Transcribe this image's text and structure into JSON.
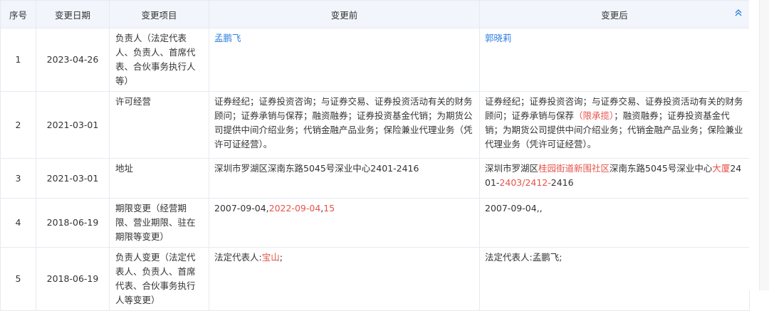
{
  "header": {
    "seq": "序号",
    "date": "变更日期",
    "item": "变更项目",
    "before": "变更前",
    "after": "变更后",
    "collapse_icon": "chevrons-up-icon",
    "accent": "#2f7fe0"
  },
  "highlight_color": "#e5534b",
  "rows": [
    {
      "seq": "1",
      "date": "2023-04-26",
      "item": "负责人（法定代表人、负责人、首席代表、合伙事务执行人等）",
      "before": [
        {
          "t": "孟鹏飞",
          "c": "link"
        }
      ],
      "after": [
        {
          "t": "郭晓莉",
          "c": "link"
        }
      ]
    },
    {
      "seq": "2",
      "date": "2021-03-01",
      "item": "许可经营",
      "before": [
        {
          "t": "证券经纪；证券投资咨询；与证券交易、证券投资活动有关的财务顾问；证券承销与保荐；融资融券；证券投资基金代销；为期货公司提供中间介绍业务；代销金融产品业务；保险兼业代理业务（凭许可证经营）。",
          "c": ""
        }
      ],
      "after": [
        {
          "t": "证券经纪；证券投资咨询；与证券交易、证券投资活动有关的财务顾问；证券承销与保荐",
          "c": ""
        },
        {
          "t": "（限承揽）",
          "c": "hl"
        },
        {
          "t": "；融资融券；证券投资基金代销；为期货公司提供中间介绍业务；代销金融产品业务；保险兼业代理业务（凭许可证经营）。",
          "c": ""
        }
      ]
    },
    {
      "seq": "3",
      "date": "2021-03-01",
      "item": "地址",
      "before": [
        {
          "t": "深圳市罗湖区深南东路5045号深业中心2401-2416",
          "c": ""
        }
      ],
      "after": [
        {
          "t": "深圳市罗湖区",
          "c": ""
        },
        {
          "t": "桂园街道新围社区",
          "c": "hl"
        },
        {
          "t": "深南东路5045号深业中心",
          "c": ""
        },
        {
          "t": "大厦",
          "c": "hl"
        },
        {
          "t": "2401-",
          "c": ""
        },
        {
          "t": "2403/2412-",
          "c": "hl"
        },
        {
          "t": "2416",
          "c": ""
        }
      ]
    },
    {
      "seq": "4",
      "date": "2018-06-19",
      "item": "期限变更（经营期限、营业期限、驻在期限等变更）",
      "before": [
        {
          "t": "2007-09-04,",
          "c": ""
        },
        {
          "t": "2022-09-04",
          "c": "hl"
        },
        {
          "t": ",",
          "c": ""
        },
        {
          "t": "15",
          "c": "hl"
        }
      ],
      "after": [
        {
          "t": "2007-09-04,,",
          "c": ""
        }
      ]
    },
    {
      "seq": "5",
      "date": "2018-06-19",
      "item": "负责人变更（法定代表人、负责人、首席代表、合伙事务执行人等变更）",
      "before": [
        {
          "t": "法定代表人:",
          "c": ""
        },
        {
          "t": "宝山",
          "c": "hl"
        },
        {
          "t": ";",
          "c": ""
        }
      ],
      "after": [
        {
          "t": "法定代表人:孟鹏飞;",
          "c": ""
        }
      ]
    }
  ]
}
